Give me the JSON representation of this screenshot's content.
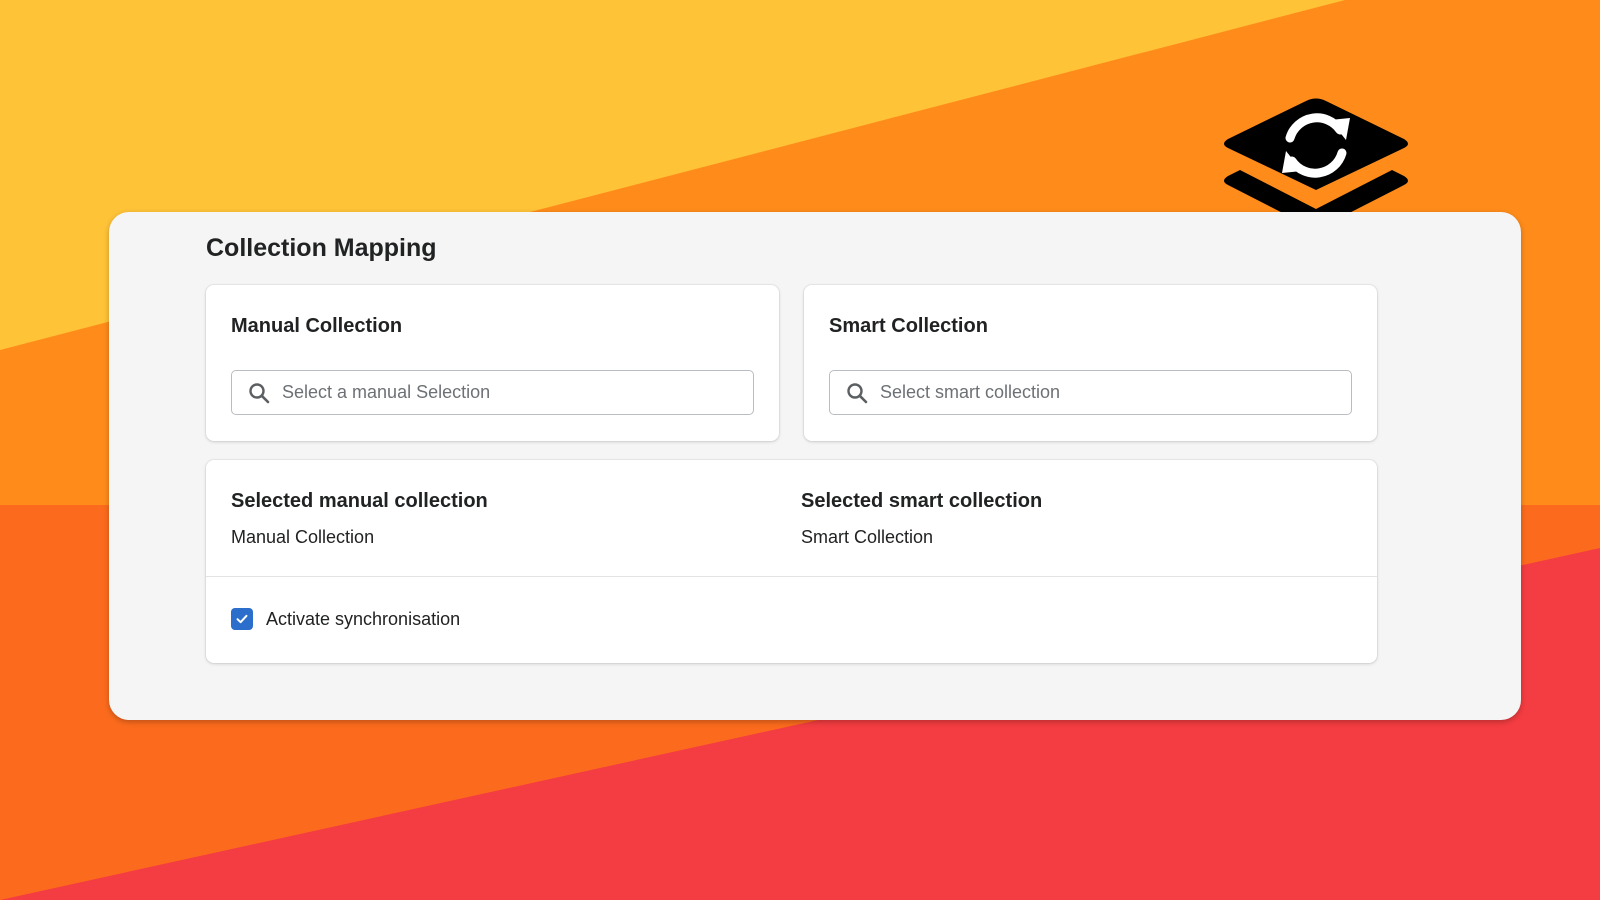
{
  "page": {
    "title": "Collection Mapping"
  },
  "colors": {
    "bg_top": "#FFC338",
    "bg_middle": "#FF8C1A",
    "bg_lower": "#FC6B1D",
    "bg_bottom": "#F43D42",
    "checkbox_accent": "#2C6ECB",
    "panel": "#F5F5F5"
  },
  "manual_card": {
    "title": "Manual Collection",
    "search_placeholder": "Select a manual Selection",
    "search_value": "",
    "icon": "search-icon"
  },
  "smart_card": {
    "title": "Smart Collection",
    "search_placeholder": "Select smart collection",
    "search_value": "",
    "icon": "search-icon"
  },
  "selected": {
    "manual_title": "Selected manual collection",
    "manual_value": "Manual Collection",
    "smart_title": "Selected smart collection",
    "smart_value": "Smart Collection"
  },
  "sync": {
    "label": "Activate synchronisation",
    "checked": true,
    "icon": "checkmark-icon"
  },
  "logo": {
    "icon": "layers-sync-icon"
  }
}
